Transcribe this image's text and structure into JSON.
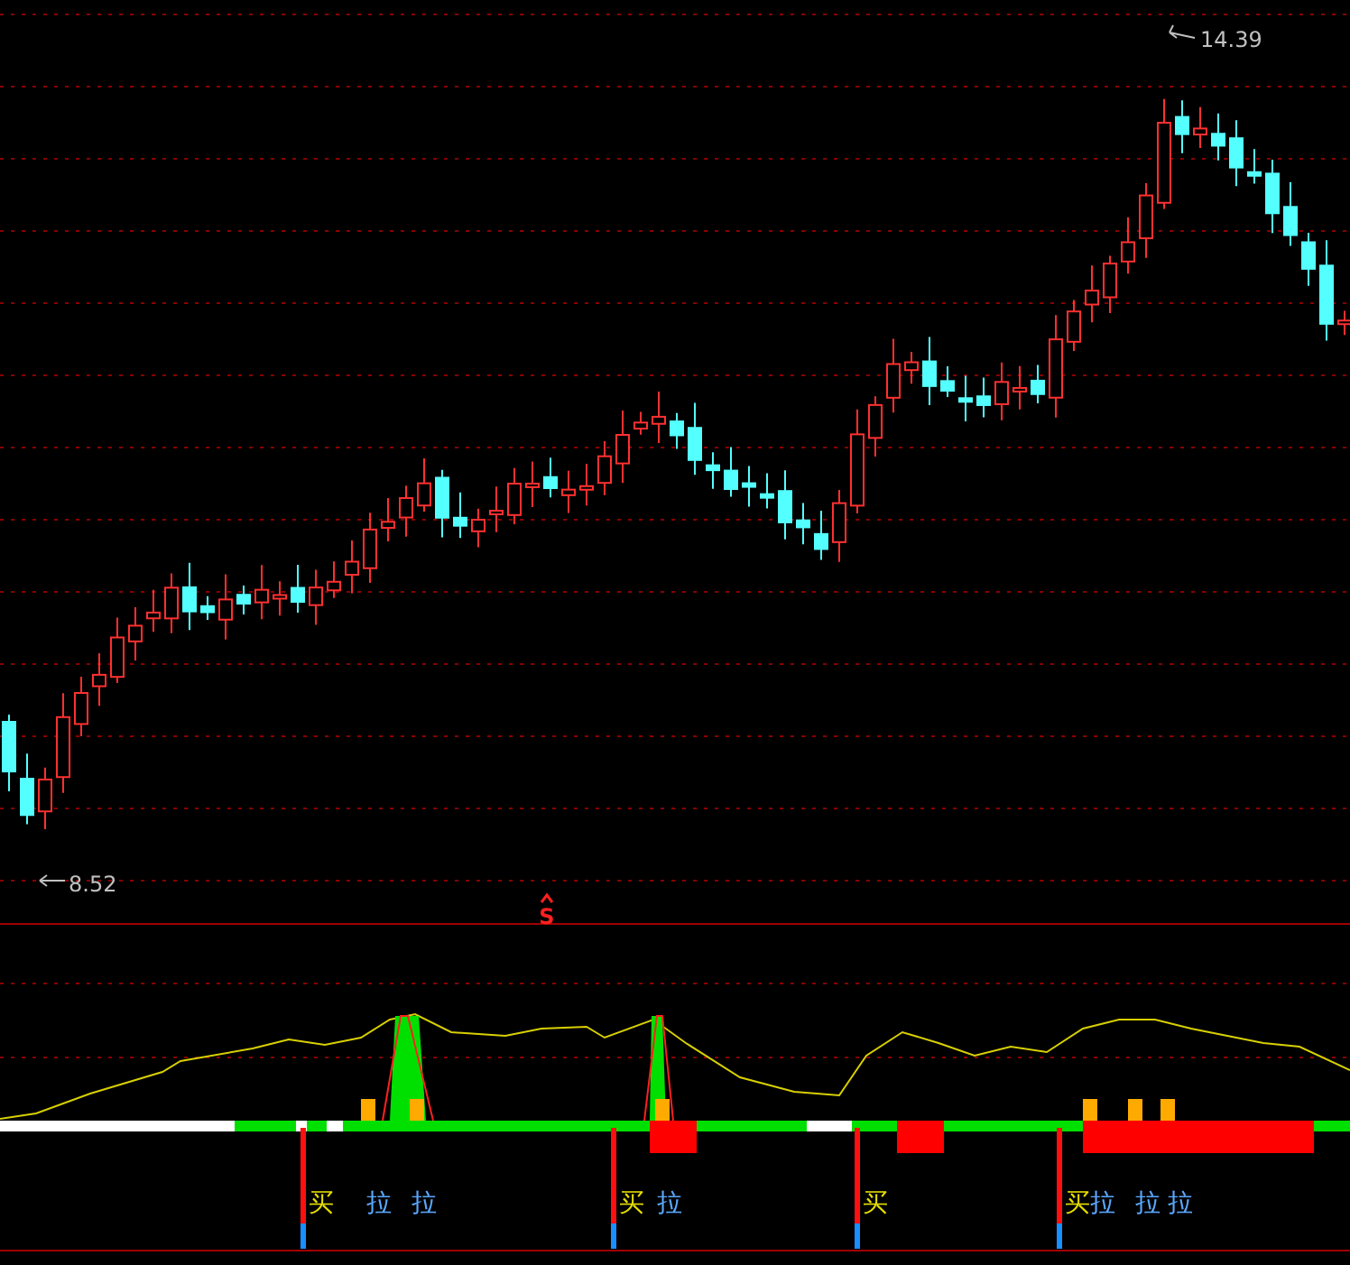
{
  "price_chart": {
    "high_label": "14.39",
    "low_label": "8.52"
  },
  "marker": {
    "label": "S"
  },
  "signals": [
    {
      "buy": "买",
      "pulls": [
        "拉",
        "拉"
      ]
    },
    {
      "buy": "买",
      "pulls": [
        "拉"
      ]
    },
    {
      "buy": "买"
    },
    {
      "buy": "买",
      "pulls": [
        "拉",
        "拉",
        "拉"
      ]
    }
  ]
}
